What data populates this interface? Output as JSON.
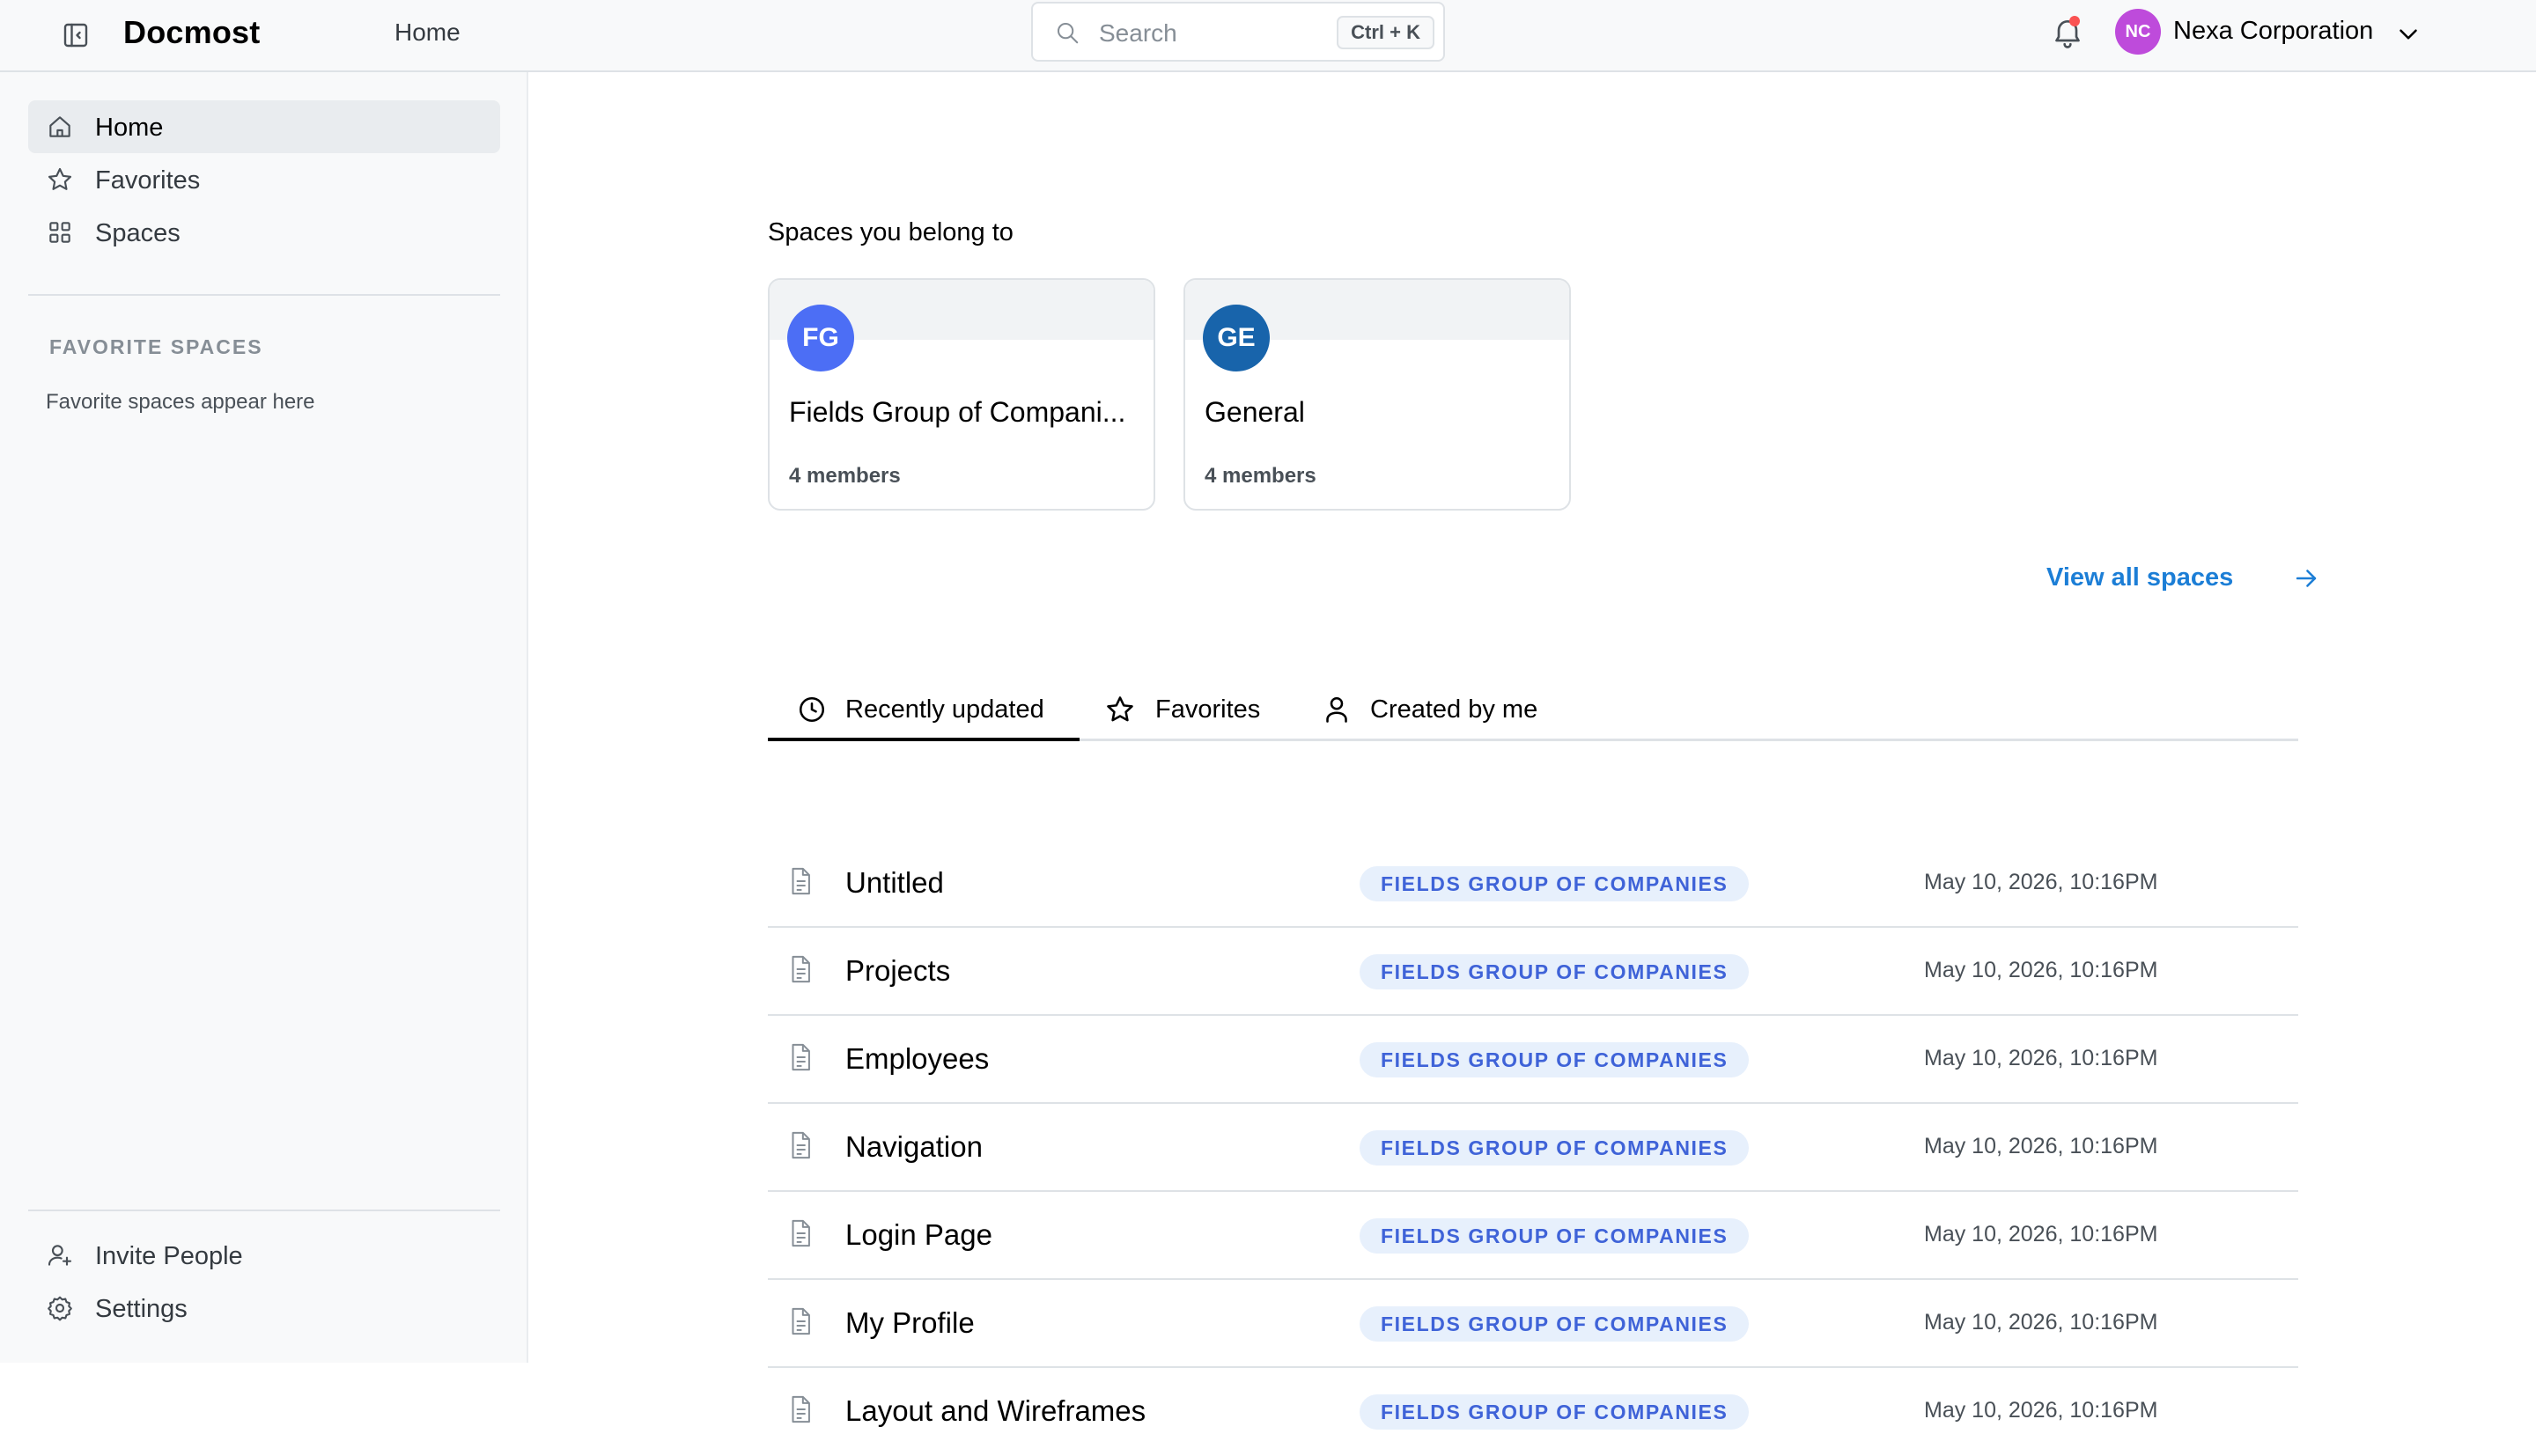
{
  "app": {
    "name": "Docmost"
  },
  "header": {
    "breadcrumb": "Home",
    "search": {
      "placeholder": "Search",
      "shortcut": "Ctrl + K"
    },
    "workspace": {
      "initials": "NC",
      "name": "Nexa Corporation",
      "avatar_color": "#be4bdb"
    },
    "notifications": {
      "has_unread": true
    }
  },
  "sidebar": {
    "nav": [
      {
        "label": "Home",
        "icon": "home-icon",
        "active": true
      },
      {
        "label": "Favorites",
        "icon": "star-icon",
        "active": false
      },
      {
        "label": "Spaces",
        "icon": "grid-icon",
        "active": false
      }
    ],
    "favorite_spaces_heading": "FAVORITE SPACES",
    "favorite_spaces_empty": "Favorite spaces appear here",
    "footer": [
      {
        "label": "Invite People",
        "icon": "user-plus-icon"
      },
      {
        "label": "Settings",
        "icon": "gear-icon"
      }
    ]
  },
  "spaces": {
    "heading": "Spaces you belong to",
    "items": [
      {
        "initials": "FG",
        "name": "Fields Group of Compani...",
        "members": "4 members",
        "color": "#4c6ef5"
      },
      {
        "initials": "GE",
        "name": "General",
        "members": "4 members",
        "color": "#1864ab"
      }
    ],
    "view_all": "View all spaces"
  },
  "tabs": [
    {
      "label": "Recently updated",
      "icon": "clock-icon",
      "active": true
    },
    {
      "label": "Favorites",
      "icon": "star-icon",
      "active": false
    },
    {
      "label": "Created by me",
      "icon": "user-icon",
      "active": false
    }
  ],
  "pages": [
    {
      "title": "Untitled",
      "space": "FIELDS GROUP OF COMPANIES",
      "updated": "May 10, 2026, 10:16PM"
    },
    {
      "title": "Projects",
      "space": "FIELDS GROUP OF COMPANIES",
      "updated": "May 10, 2026, 10:16PM"
    },
    {
      "title": "Employees",
      "space": "FIELDS GROUP OF COMPANIES",
      "updated": "May 10, 2026, 10:16PM"
    },
    {
      "title": "Navigation",
      "space": "FIELDS GROUP OF COMPANIES",
      "updated": "May 10, 2026, 10:16PM"
    },
    {
      "title": "Login Page",
      "space": "FIELDS GROUP OF COMPANIES",
      "updated": "May 10, 2026, 10:16PM"
    },
    {
      "title": "My Profile",
      "space": "FIELDS GROUP OF COMPANIES",
      "updated": "May 10, 2026, 10:16PM"
    },
    {
      "title": "Layout and Wireframes",
      "space": "FIELDS GROUP OF COMPANIES",
      "updated": "May 10, 2026, 10:16PM"
    }
  ],
  "colors": {
    "accent": "#1c7ed6",
    "badge_bg": "#e7f0fc",
    "badge_text": "#3f63d8",
    "notification_dot": "#fa5252"
  }
}
